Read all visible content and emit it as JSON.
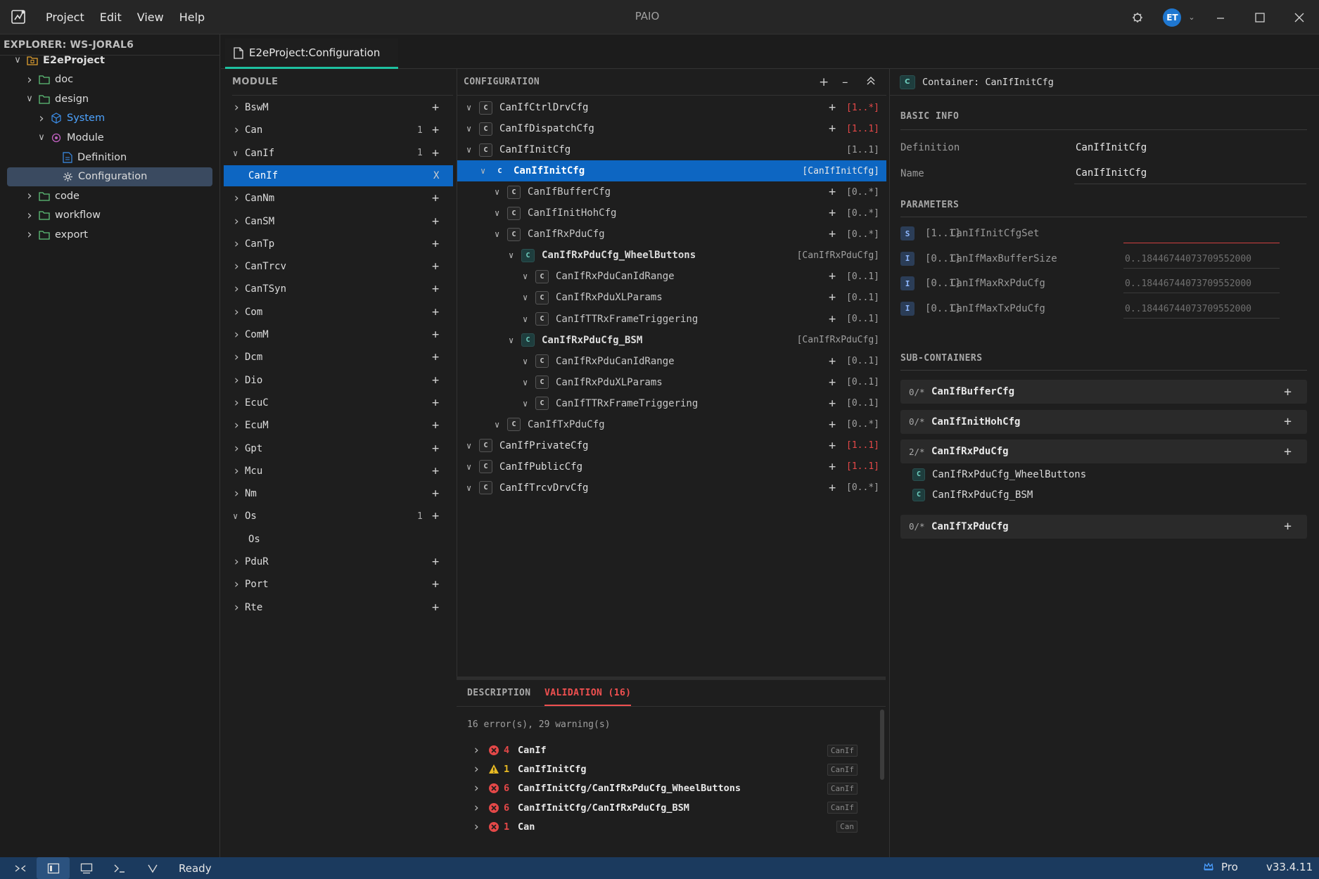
{
  "titlebar": {
    "menu": [
      "Project",
      "Edit",
      "View",
      "Help"
    ],
    "app_title": "PAIO",
    "avatar_initials": "ET"
  },
  "explorer": {
    "title": "EXPLORER: WS-JORAL6",
    "items": [
      {
        "label": "E2eProject",
        "depth": 0,
        "expanded": true,
        "icon": "project-folder-icon",
        "bold": true
      },
      {
        "label": "doc",
        "depth": 1,
        "expanded": false,
        "icon": "folder-icon"
      },
      {
        "label": "design",
        "depth": 1,
        "expanded": true,
        "icon": "folder-icon"
      },
      {
        "label": "System",
        "depth": 2,
        "expanded": false,
        "icon": "cube-icon",
        "accent": true
      },
      {
        "label": "Module",
        "depth": 2,
        "expanded": true,
        "icon": "module-icon"
      },
      {
        "label": "Definition",
        "depth": 3,
        "icon": "document-icon"
      },
      {
        "label": "Configuration",
        "depth": 3,
        "icon": "gear-icon",
        "selected": true
      },
      {
        "label": "code",
        "depth": 1,
        "expanded": false,
        "icon": "folder-icon"
      },
      {
        "label": "workflow",
        "depth": 1,
        "expanded": false,
        "icon": "folder-icon"
      },
      {
        "label": "export",
        "depth": 1,
        "expanded": false,
        "icon": "folder-icon"
      }
    ]
  },
  "editor_tab": {
    "label": "E2eProject:Configuration"
  },
  "module_panel": {
    "title": "MODULE",
    "items": [
      {
        "name": "BswM",
        "count": "",
        "expanded": false
      },
      {
        "name": "Can",
        "count": "1",
        "expanded": false
      },
      {
        "name": "CanIf",
        "count": "1",
        "expanded": true
      },
      {
        "name": "CanIf",
        "child": true,
        "selected": true,
        "action": "X"
      },
      {
        "name": "CanNm",
        "count": "",
        "expanded": false
      },
      {
        "name": "CanSM",
        "count": "",
        "expanded": false
      },
      {
        "name": "CanTp",
        "count": "",
        "expanded": false
      },
      {
        "name": "CanTrcv",
        "count": "",
        "expanded": false
      },
      {
        "name": "CanTSyn",
        "count": "",
        "expanded": false
      },
      {
        "name": "Com",
        "count": "",
        "expanded": false
      },
      {
        "name": "ComM",
        "count": "",
        "expanded": false
      },
      {
        "name": "Dcm",
        "count": "",
        "expanded": false
      },
      {
        "name": "Dio",
        "count": "",
        "expanded": false
      },
      {
        "name": "EcuC",
        "count": "",
        "expanded": false
      },
      {
        "name": "EcuM",
        "count": "",
        "expanded": false
      },
      {
        "name": "Gpt",
        "count": "",
        "expanded": false
      },
      {
        "name": "Mcu",
        "count": "",
        "expanded": false
      },
      {
        "name": "Nm",
        "count": "",
        "expanded": false
      },
      {
        "name": "Os",
        "count": "1",
        "expanded": true
      },
      {
        "name": "Os",
        "child": true
      },
      {
        "name": "PduR",
        "count": "",
        "expanded": false
      },
      {
        "name": "Port",
        "count": "",
        "expanded": false
      },
      {
        "name": "Rte",
        "count": "",
        "expanded": false
      }
    ]
  },
  "config_panel": {
    "title": "CONFIGURATION",
    "items": [
      {
        "name": "CanIfCtrlDrvCfg",
        "depth": 0,
        "plus": true,
        "mult": "[1..*]",
        "red": true
      },
      {
        "name": "CanIfDispatchCfg",
        "depth": 0,
        "plus": true,
        "mult": "[1..1]",
        "red": true
      },
      {
        "name": "CanIfInitCfg",
        "depth": 0,
        "plus": false,
        "mult": "[1..1]",
        "red": false
      },
      {
        "name": "CanIfInitCfg",
        "depth": 1,
        "plus": false,
        "mult": "[CanIfInitCfg]",
        "selected": true,
        "bold": true
      },
      {
        "name": "CanIfBufferCfg",
        "depth": 2,
        "plus": true,
        "mult": "[0..*]"
      },
      {
        "name": "CanIfInitHohCfg",
        "depth": 2,
        "plus": true,
        "mult": "[0..*]"
      },
      {
        "name": "CanIfRxPduCfg",
        "depth": 2,
        "plus": true,
        "mult": "[0..*]"
      },
      {
        "name": "CanIfRxPduCfg_WheelButtons",
        "depth": 3,
        "plus": false,
        "mult": "[CanIfRxPduCfg]",
        "bold": true
      },
      {
        "name": "CanIfRxPduCanIdRange",
        "depth": 4,
        "plus": true,
        "mult": "[0..1]"
      },
      {
        "name": "CanIfRxPduXLParams",
        "depth": 4,
        "plus": true,
        "mult": "[0..1]"
      },
      {
        "name": "CanIfTTRxFrameTriggering",
        "depth": 4,
        "plus": true,
        "mult": "[0..1]"
      },
      {
        "name": "CanIfRxPduCfg_BSM",
        "depth": 3,
        "plus": false,
        "mult": "[CanIfRxPduCfg]",
        "bold": true
      },
      {
        "name": "CanIfRxPduCanIdRange",
        "depth": 4,
        "plus": true,
        "mult": "[0..1]"
      },
      {
        "name": "CanIfRxPduXLParams",
        "depth": 4,
        "plus": true,
        "mult": "[0..1]"
      },
      {
        "name": "CanIfTTRxFrameTriggering",
        "depth": 4,
        "plus": true,
        "mult": "[0..1]"
      },
      {
        "name": "CanIfTxPduCfg",
        "depth": 2,
        "plus": true,
        "mult": "[0..*]"
      },
      {
        "name": "CanIfPrivateCfg",
        "depth": 0,
        "plus": true,
        "mult": "[1..1]",
        "red": true
      },
      {
        "name": "CanIfPublicCfg",
        "depth": 0,
        "plus": true,
        "mult": "[1..1]",
        "red": true
      },
      {
        "name": "CanIfTrcvDrvCfg",
        "depth": 0,
        "plus": true,
        "mult": "[0..*]"
      }
    ]
  },
  "bottom_panel": {
    "tab_description": "DESCRIPTION",
    "tab_validation": "VALIDATION (16)",
    "summary": "16 error(s), 29 warning(s)",
    "items": [
      {
        "type": "error",
        "count": "4",
        "name": "CanIf",
        "tag": "CanIf"
      },
      {
        "type": "warning",
        "count": "1",
        "name": "CanIfInitCfg",
        "tag": "CanIf"
      },
      {
        "type": "error",
        "count": "6",
        "name": "CanIfInitCfg/CanIfRxPduCfg_WheelButtons",
        "tag": "CanIf"
      },
      {
        "type": "error",
        "count": "6",
        "name": "CanIfInitCfg/CanIfRxPduCfg_BSM",
        "tag": "CanIf"
      },
      {
        "type": "error",
        "count": "1",
        "name": "Can",
        "tag": "Can"
      }
    ]
  },
  "props_panel": {
    "header": "Container: CanIfInitCfg",
    "basic_info_title": "BASIC INFO",
    "definition_label": "Definition",
    "definition_value": "CanIfInitCfg",
    "name_label": "Name",
    "name_value": "CanIfInitCfg",
    "parameters_title": "PARAMETERS",
    "parameters": [
      {
        "badge": "S",
        "mult": "[1..1]",
        "name": "CanIfInitCfgSet",
        "value": "",
        "invalid": true
      },
      {
        "badge": "I",
        "mult": "[0..1]",
        "name": "CanIfMaxBufferSize",
        "value": "0..18446744073709552000"
      },
      {
        "badge": "I",
        "mult": "[0..1]",
        "name": "CanIfMaxRxPduCfg",
        "value": "0..18446744073709552000"
      },
      {
        "badge": "I",
        "mult": "[0..1]",
        "name": "CanIfMaxTxPduCfg",
        "value": "0..18446744073709552000"
      }
    ],
    "subcontainers_title": "SUB-CONTAINERS",
    "subcontainers": [
      {
        "card": "0/*",
        "name": "CanIfBufferCfg",
        "children": []
      },
      {
        "card": "0/*",
        "name": "CanIfInitHohCfg",
        "children": []
      },
      {
        "card": "2/*",
        "name": "CanIfRxPduCfg",
        "children": [
          "CanIfRxPduCfg_WheelButtons",
          "CanIfRxPduCfg_BSM"
        ]
      },
      {
        "card": "0/*",
        "name": "CanIfTxPduCfg",
        "children": []
      }
    ]
  },
  "statusbar": {
    "status": "Ready",
    "edition": "Pro",
    "version": "v33.4.11"
  },
  "colors": {
    "accent": "#0d66c2",
    "tab_underline": "#1ec0a0",
    "error": "#e44848",
    "warning": "#e8b923",
    "statusbar": "#1b3a5e"
  }
}
